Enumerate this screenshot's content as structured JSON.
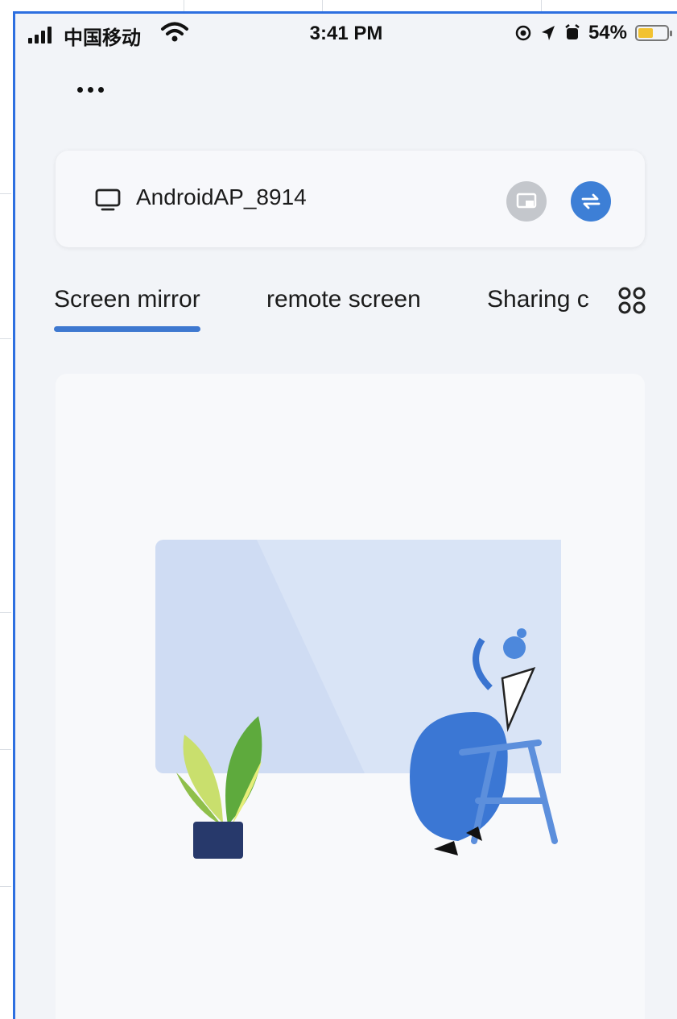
{
  "status_bar": {
    "carrier": "中国移动",
    "time": "3:41 PM",
    "battery": "54%",
    "battery_level": 0.54
  },
  "device": {
    "name": "AndroidAP_8914"
  },
  "tabs": [
    {
      "label": "Screen mirror",
      "active": true
    },
    {
      "label": "remote screen",
      "active": false
    },
    {
      "label": "Sharing c",
      "active": false
    }
  ],
  "colors": {
    "accent": "#3e78d0",
    "switch_button": "#3d7fd6",
    "cast_button_disabled": "#c4c7cc",
    "background": "#f2f4f8"
  },
  "icons": {
    "menu": "more-dots-icon",
    "device": "monitor-icon",
    "cast": "screen-cast-icon",
    "switch": "switch-arrows-icon",
    "tabs_more": "grid-icon"
  }
}
